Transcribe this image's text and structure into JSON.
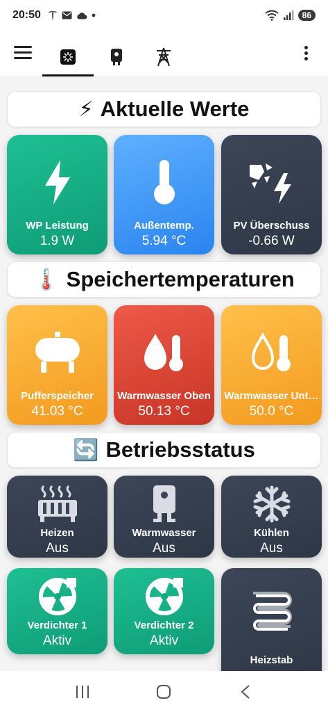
{
  "status_bar": {
    "time": "20:50",
    "icons": [
      "tesla-icon",
      "mail-icon",
      "cloud-icon",
      "dot-icon"
    ],
    "battery": "86"
  },
  "app_bar": {
    "tabs": [
      {
        "icon": "dashboard-icon",
        "active": true
      },
      {
        "icon": "heat-pump-icon",
        "active": false
      },
      {
        "icon": "power-tower-icon",
        "active": false
      }
    ]
  },
  "sections": {
    "current": {
      "emoji": "⚡",
      "title": "Aktuelle Werte"
    },
    "storage": {
      "emoji": "🌡️",
      "title": "Speichertemperaturen"
    },
    "status": {
      "emoji": "🔄",
      "title": "Betriebsstatus"
    }
  },
  "current_values": [
    {
      "label": "WP Leistung",
      "value": "1.9 W",
      "icon": "lightning-icon",
      "color": "#12a982"
    },
    {
      "label": "Außentemp.",
      "value": "5.94 °C",
      "icon": "thermometer-icon",
      "color": "#3d96f7"
    },
    {
      "label": "PV Überschuss",
      "value": "-0.66 W",
      "icon": "solar-power-icon",
      "color": "#343e4e"
    }
  ],
  "storage_values": [
    {
      "label": "Pufferspeicher",
      "value": "41.03 °C",
      "icon": "tank-icon",
      "color": "#f8ad33"
    },
    {
      "label": "Warmwasser Oben",
      "value": "50.13 °C",
      "icon": "water-temp-icon",
      "color": "#dd4636"
    },
    {
      "label": "Warmwasser Unt…",
      "value": "50.0 °C",
      "icon": "water-temp-outline-icon",
      "color": "#f8ad33"
    }
  ],
  "operating_status": [
    {
      "label": "Heizen",
      "value": "Aus",
      "icon": "radiator-icon",
      "color": "#343e4e"
    },
    {
      "label": "Warmwasser",
      "value": "Aus",
      "icon": "water-boiler-icon",
      "color": "#343e4e"
    },
    {
      "label": "Kühlen",
      "value": "Aus",
      "icon": "snowflake-icon",
      "color": "#343e4e"
    },
    {
      "label": "Verdichter 1",
      "value": "Aktiv",
      "icon": "fan-icon",
      "color": "#12a982"
    },
    {
      "label": "Verdichter 2",
      "value": "Aktiv",
      "icon": "fan-icon",
      "color": "#12a982"
    },
    {
      "label": "Heizstab",
      "value": "",
      "icon": "heating-coil-icon",
      "color": "#343e4e"
    }
  ],
  "nav_bar": [
    "recent-apps-icon",
    "home-icon",
    "back-icon"
  ]
}
